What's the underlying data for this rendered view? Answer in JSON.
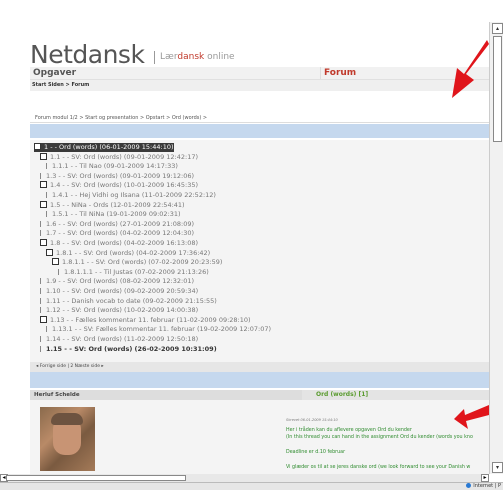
{
  "brand": {
    "name": "Netdansk",
    "sub_prefix": "Lær",
    "sub_red": "dansk",
    "sub_suffix": " online"
  },
  "nav": {
    "left": "Opgaver",
    "forum": "Forum"
  },
  "breadcrumb": "Start Siden > Forum",
  "path": "Forum modul 1/2 > Start og presentation > Opstart > Ord (words) >",
  "tree": [
    {
      "text": "1 - - Ord (words) (06-01-2009 15:44:10)",
      "indent": 0,
      "marker": "box",
      "style": "sel"
    },
    {
      "text": "1.1 - - SV: Ord (words) (09-01-2009 12:42:17)",
      "indent": 1,
      "marker": "box",
      "style": ""
    },
    {
      "text": "1.1.1 - - Til Nao (09-01-2009 14:17:33)",
      "indent": 2,
      "marker": "tick",
      "style": ""
    },
    {
      "text": "1.3 - - SV: Ord (words) (09-01-2009 19:12:06)",
      "indent": 1,
      "marker": "tick",
      "style": ""
    },
    {
      "text": "1.4 - - SV: Ord (words) (10-01-2009 16:45:35)",
      "indent": 1,
      "marker": "box",
      "style": ""
    },
    {
      "text": "1.4.1 - - Hej Vidhi og Ilsana (11-01-2009 22:52:12)",
      "indent": 2,
      "marker": "tick",
      "style": ""
    },
    {
      "text": "1.5 - - NiNa - Ords (12-01-2009 22:54:41)",
      "indent": 1,
      "marker": "box",
      "style": ""
    },
    {
      "text": "1.5.1 - - Til NiNa (19-01-2009 09:02:31)",
      "indent": 2,
      "marker": "tick",
      "style": ""
    },
    {
      "text": "1.6 - - SV: Ord (words) (27-01-2009 21:08:09)",
      "indent": 1,
      "marker": "tick",
      "style": ""
    },
    {
      "text": "1.7 - - SV: Ord (words) (04-02-2009 12:04:30)",
      "indent": 1,
      "marker": "tick",
      "style": ""
    },
    {
      "text": "1.8 - - SV: Ord (words) (04-02-2009 16:13:08)",
      "indent": 1,
      "marker": "box",
      "style": ""
    },
    {
      "text": "1.8.1 - - SV: Ord (words) (04-02-2009 17:36:42)",
      "indent": 2,
      "marker": "box",
      "style": ""
    },
    {
      "text": "1.8.1.1 - - SV: Ord (words) (07-02-2009 20:23:59)",
      "indent": 3,
      "marker": "box",
      "style": ""
    },
    {
      "text": "1.8.1.1.1 - - Til Justas (07-02-2009 21:13:26)",
      "indent": 4,
      "marker": "tick",
      "style": ""
    },
    {
      "text": "1.9 - - SV: Ord (words) (08-02-2009 12:32:01)",
      "indent": 1,
      "marker": "tick",
      "style": ""
    },
    {
      "text": "1.10 - - SV: Ord (words) (09-02-2009 20:59:34)",
      "indent": 1,
      "marker": "tick",
      "style": ""
    },
    {
      "text": "1.11 - - Danish vocab to date (09-02-2009 21:15:55)",
      "indent": 1,
      "marker": "tick",
      "style": ""
    },
    {
      "text": "1.12 - - SV: Ord (words) (10-02-2009 14:00:38)",
      "indent": 1,
      "marker": "tick",
      "style": ""
    },
    {
      "text": "1.13 - - Fælles kommentar 11. februar (11-02-2009 09:28:10)",
      "indent": 1,
      "marker": "box",
      "style": ""
    },
    {
      "text": "1.13.1 - - SV: Fælles kommentar 11. februar (19-02-2009 12:07:07)",
      "indent": 2,
      "marker": "tick",
      "style": ""
    },
    {
      "text": "1.14 - - SV: Ord (words) (11-02-2009 12:50:18)",
      "indent": 1,
      "marker": "tick",
      "style": ""
    },
    {
      "text": "1.15 - - SV: Ord (words) (26-02-2009 10:31:09)",
      "indent": 1,
      "marker": "tick",
      "style": "bold"
    }
  ],
  "pager": "◂  Forrige side  |  2 Næste side  ▸",
  "message": {
    "author": "Herluf Schelde",
    "title": "Ord (words) [1]",
    "date": "Skrevet 06-01-2009 15:44:10",
    "lines": [
      "Her i tråden kan du aflevere opgaven Ord du kender",
      "(In this thread you can hand in the assignment Ord du kender (words you kno",
      "Deadline er d.10 februar",
      "Vi glæder os til at se jeres danske ord (we look forward to see your Danish w"
    ]
  },
  "status": {
    "zone": "Internet | P"
  },
  "colors": {
    "forum_red": "#c0392b",
    "selected_row": "#3a3a3a",
    "band_blue": "#c5d8ee",
    "message_green": "#2e8b2e",
    "annotation_red": "#e0151b"
  }
}
